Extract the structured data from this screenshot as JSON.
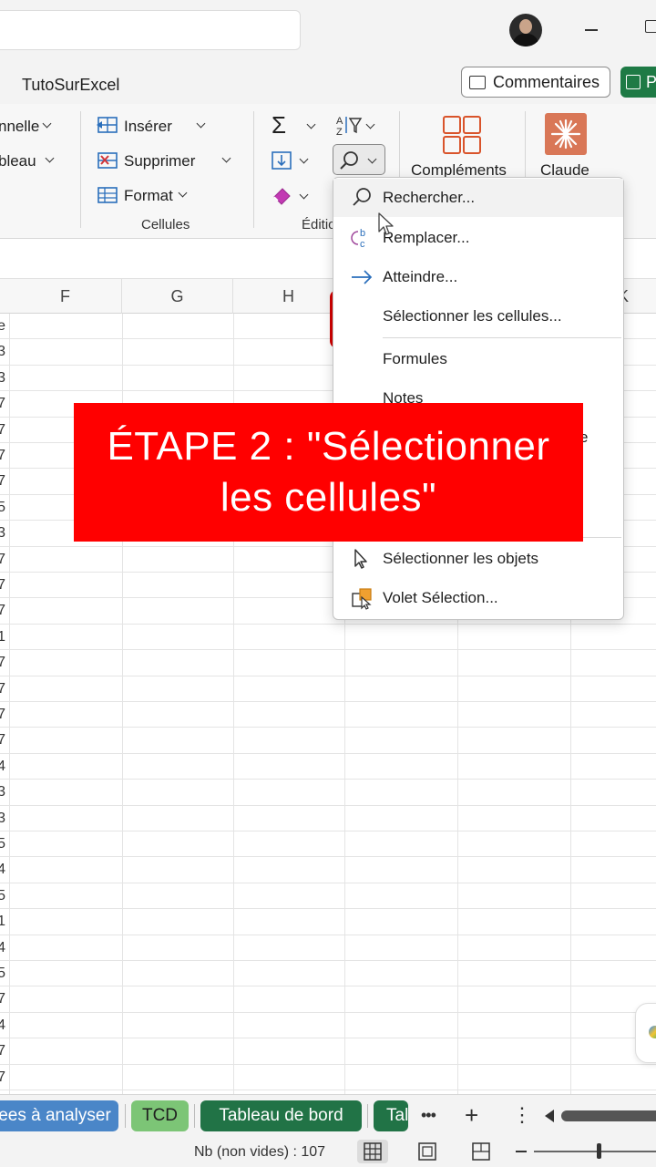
{
  "titlebar": {
    "workbook_name": "TutoSurExcel"
  },
  "header_buttons": {
    "comments_label": "Commentaires",
    "share_label": "P"
  },
  "ribbon": {
    "left_partial": {
      "item1": "nnelle",
      "item2": "bleau"
    },
    "cells_group": {
      "insert_label": "Insérer",
      "delete_label": "Supprimer",
      "format_label": "Format",
      "group_label": "Cellules"
    },
    "editing_group": {
      "group_label": "Éditio"
    },
    "addins_label": "Compléments",
    "claude_label": "Claude"
  },
  "columns": [
    "F",
    "G",
    "H",
    "K"
  ],
  "row_values": [
    "e",
    "3",
    "3",
    "7",
    "7",
    "7",
    "7",
    "5",
    "3",
    "7",
    "7",
    "7",
    "1",
    "7",
    "7",
    "7",
    "7",
    "4",
    "3",
    "3",
    "5",
    "4",
    "5",
    "1",
    "4",
    "5",
    "7",
    "4",
    "7",
    "7"
  ],
  "find_menu": {
    "items": [
      {
        "label": "Rechercher...",
        "icon": "search-icon"
      },
      {
        "label": "Remplacer...",
        "icon": "replace-icon"
      },
      {
        "label": "Atteindre...",
        "icon": "arrow-right-icon"
      },
      {
        "label": "Sélectionner les cellules...",
        "icon": ""
      },
      {
        "label": "Formules",
        "icon": ""
      },
      {
        "label": "Notes",
        "icon": ""
      },
      {
        "label": "e",
        "icon": ""
      },
      {
        "label": "Sélectionner les objets",
        "icon": "pointer-icon"
      },
      {
        "label": "Volet Sélection...",
        "icon": "selection-pane-icon"
      }
    ]
  },
  "banner": {
    "line1": "ÉTAPE 2 : \"Sélectionner",
    "line2": "les cellules\""
  },
  "sheet_tabs": [
    {
      "label": "ees à analyser",
      "color": "#4a86c8",
      "text_color": "#ffffff"
    },
    {
      "label": "TCD",
      "color": "#7cc576",
      "text_color": "#1f1f1f"
    },
    {
      "label": "Tableau de bord",
      "color": "#217346",
      "text_color": "#ffffff"
    },
    {
      "label": "Tal",
      "color": "#217346",
      "text_color": "#ffffff"
    }
  ],
  "tab_controls": {
    "more": "•••",
    "add": "+",
    "options": "⋮"
  },
  "statusbar": {
    "count_text": "Nb (non vides) : 107"
  },
  "colors": {
    "excel_green": "#217346",
    "banner_red": "#ff0000",
    "bracket_red": "#d40000"
  }
}
